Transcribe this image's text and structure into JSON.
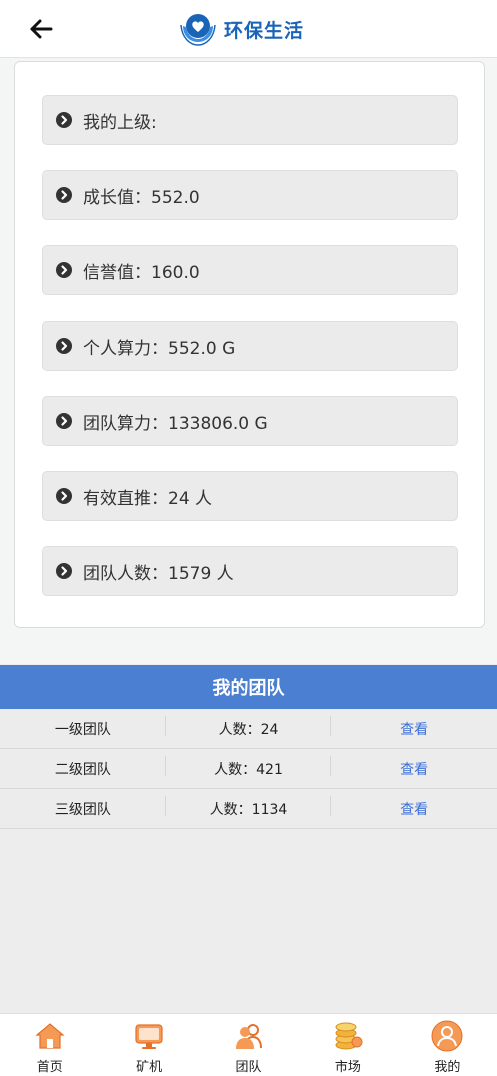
{
  "header": {
    "back_icon": "arrow-left-icon",
    "logo_icon": "hands-heart-logo-icon",
    "app_name": "环保生活",
    "brand_color": "#1a64b8"
  },
  "info": {
    "items": [
      {
        "label": "我的上级:",
        "icon": "chevron-circle-right-icon"
      },
      {
        "label": "成长值：552.0",
        "icon": "chevron-circle-right-icon"
      },
      {
        "label": "信誉值：160.0",
        "icon": "chevron-circle-right-icon"
      },
      {
        "label": "个人算力：552.0 G",
        "icon": "chevron-circle-right-icon"
      },
      {
        "label": "团队算力：133806.0 G",
        "icon": "chevron-circle-right-icon"
      },
      {
        "label": "有效直推：24 人",
        "icon": "chevron-circle-right-icon"
      },
      {
        "label": "团队人数：1579 人",
        "icon": "chevron-circle-right-icon"
      }
    ]
  },
  "team": {
    "title": "我的团队",
    "title_bg": "#4a7fd1",
    "rows": [
      {
        "name": "一级团队",
        "count": "人数：24",
        "action": "查看"
      },
      {
        "name": "二级团队",
        "count": "人数：421",
        "action": "查看"
      },
      {
        "name": "三级团队",
        "count": "人数：1134",
        "action": "查看"
      }
    ]
  },
  "nav": {
    "items": [
      {
        "label": "首页",
        "icon": "home-icon"
      },
      {
        "label": "矿机",
        "icon": "monitor-icon"
      },
      {
        "label": "团队",
        "icon": "team-icon"
      },
      {
        "label": "市场",
        "icon": "coins-icon"
      },
      {
        "label": "我的",
        "icon": "profile-icon"
      }
    ],
    "accent": "#f0883a"
  }
}
